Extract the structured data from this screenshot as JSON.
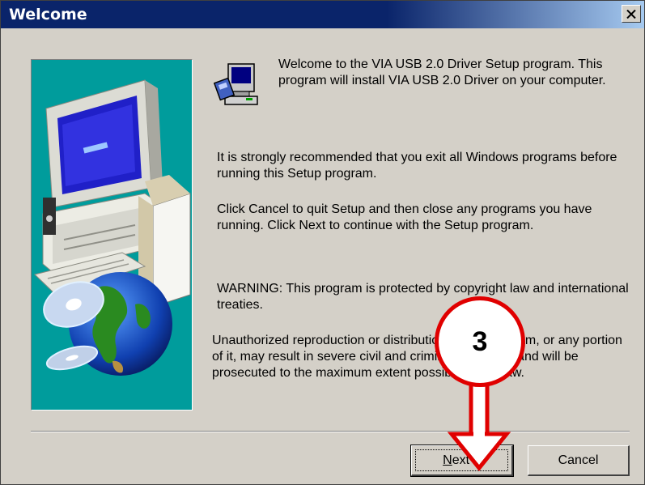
{
  "window": {
    "title": "Welcome",
    "close_glyph": "×"
  },
  "content": {
    "intro": "Welcome to the VIA USB 2.0 Driver Setup program. This program will install VIA USB 2.0 Driver on your computer.",
    "recommend": "It is strongly recommended that you exit all Windows programs before running this Setup program.",
    "instructions": "Click Cancel to quit Setup and then close any programs you have running.  Click Next to continue with the Setup program.",
    "warning": "WARNING: This program is protected by copyright law and international treaties.",
    "legal": "Unauthorized reproduction or distribution of this program, or any portion of it, may result in severe civil and criminal penalties, and will be prosecuted to the maximum extent possible under law."
  },
  "buttons": {
    "next_underlined": "N",
    "next_rest": "ext >",
    "cancel_label": "Cancel"
  },
  "annotation": {
    "step_number": "3",
    "color": "#e00000"
  },
  "colors": {
    "titlebar": "#0a246a",
    "dialog_bg": "#d4d0c8",
    "panel_bg": "#009c9c"
  },
  "icons": [
    "setup-computer-icon",
    "close-icon",
    "computer-illustration",
    "globe-illustration",
    "cd-illustration"
  ]
}
